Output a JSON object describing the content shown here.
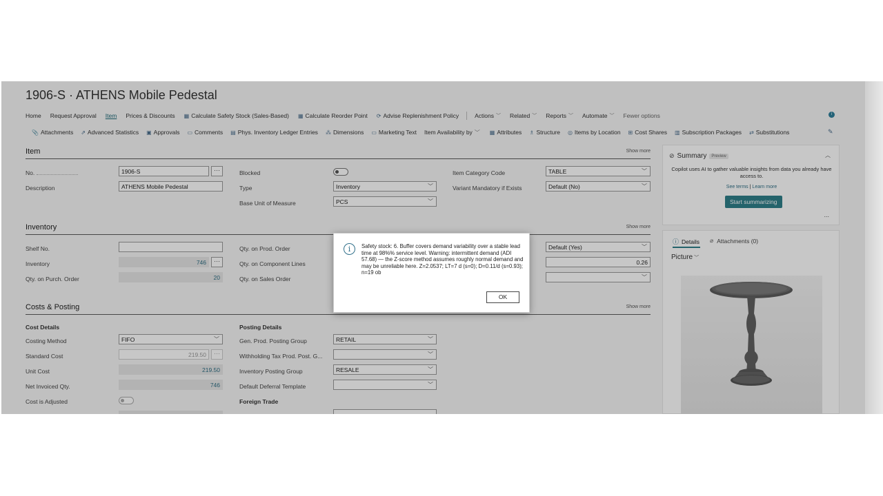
{
  "page": {
    "title": "1906-S · ATHENS Mobile Pedestal"
  },
  "nav": {
    "items": [
      "Home",
      "Request Approval",
      "Item",
      "Prices & Discounts",
      "Calculate Safety Stock (Sales-Based)",
      "Calculate Reorder Point",
      "Advise Replenishment Policy"
    ],
    "menus": [
      "Actions",
      "Related",
      "Reports",
      "Automate"
    ],
    "fewer_options": "Fewer options"
  },
  "toolbar": {
    "items": [
      "Attachments",
      "Advanced Statistics",
      "Approvals",
      "Comments",
      "Phys. Inventory Ledger Entries",
      "Dimensions",
      "Marketing Text",
      "Item Availability by",
      "Attributes",
      "Structure",
      "Items by Location",
      "Cost Shares",
      "Subscription Packages",
      "Substitutions"
    ]
  },
  "item_section": {
    "title": "Item",
    "show_more": "Show more",
    "no_label": "No.",
    "no_value": "1906-S",
    "description_label": "Description",
    "description_value": "ATHENS Mobile Pedestal",
    "blocked_label": "Blocked",
    "type_label": "Type",
    "type_value": "Inventory",
    "base_uom_label": "Base Unit of Measure",
    "base_uom_value": "PCS",
    "category_label": "Item Category Code",
    "category_value": "TABLE",
    "variant_label": "Variant Mandatory if Exists",
    "variant_value": "Default (No)"
  },
  "inventory_section": {
    "title": "Inventory",
    "show_more": "Show more",
    "shelf_label": "Shelf No.",
    "shelf_value": "",
    "inventory_label": "Inventory",
    "inventory_value": "746",
    "qty_purch_label": "Qty. on Purch. Order",
    "qty_purch_value": "20",
    "qty_prod_label": "Qty. on Prod. Order",
    "qty_comp_label": "Qty. on Component Lines",
    "qty_sales_label": "Qty. on Sales Order",
    "right_select_value": "Default (Yes)",
    "right_num_value": "0.26"
  },
  "costs_section": {
    "title": "Costs & Posting",
    "show_more": "Show more",
    "cost_details": "Cost Details",
    "costing_method_label": "Costing Method",
    "costing_method_value": "FIFO",
    "standard_cost_label": "Standard Cost",
    "standard_cost_value": "219.50",
    "unit_cost_label": "Unit Cost",
    "unit_cost_value": "219.50",
    "net_invoiced_label": "Net Invoiced Qty.",
    "net_invoiced_value": "746",
    "cost_adjusted_label": "Cost is Adjusted",
    "posting_details": "Posting Details",
    "gen_prod_label": "Gen. Prod. Posting Group",
    "gen_prod_value": "RETAIL",
    "withholding_label": "Withholding Tax Prod. Post. G...",
    "withholding_value": "",
    "inv_posting_label": "Inventory Posting Group",
    "inv_posting_value": "RESALE",
    "deferral_label": "Default Deferral Template",
    "deferral_value": "",
    "foreign_trade": "Foreign Trade"
  },
  "summary_panel": {
    "title": "Summary",
    "badge": "Preview",
    "text": "Copilot uses AI to gather valuable insights from data you already have access to.",
    "see_terms": "See terms",
    "divider": "|",
    "learn_more": "Learn more",
    "button": "Start summarizing",
    "more": "..."
  },
  "details_panel": {
    "tab_details": "Details",
    "tab_attachments": "Attachments (0)",
    "picture_label": "Picture"
  },
  "dialog": {
    "message": "Safety stock: 6. Buffer covers demand variability over a stable lead time at 98%% service level. Warning: intermittent demand (ADI 57.68) — the Z-score method assumes roughly normal demand and may be unreliable here. Z=2.0537; LT=7 d (s=0); D=0.11/d (s=0.93); n=19 ob",
    "ok_label": "OK"
  }
}
